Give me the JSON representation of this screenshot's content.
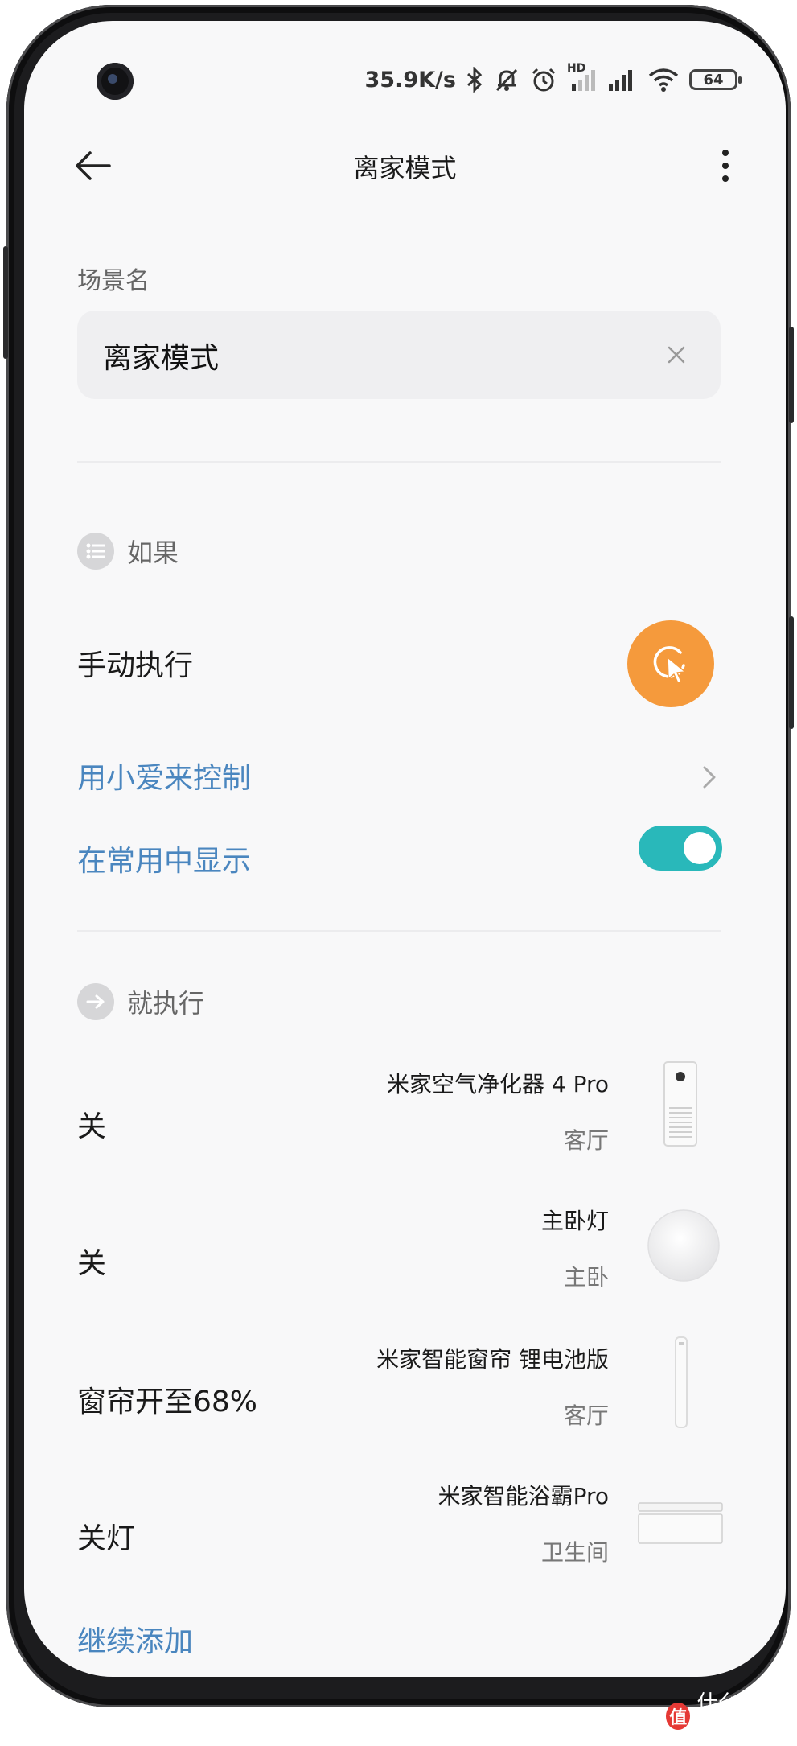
{
  "status_bar": {
    "net_speed": "35.9K/s",
    "hd_label": "HD",
    "battery": "64",
    "icons": [
      "bluetooth-icon",
      "muted-bell-icon",
      "alarm-icon",
      "signal-icon",
      "signal-icon",
      "wifi-icon",
      "battery-icon"
    ]
  },
  "header": {
    "title": "离家模式"
  },
  "scene": {
    "label": "场景名",
    "value": "离家模式"
  },
  "if_section": {
    "title": "如果",
    "condition": "手动执行",
    "xiaoai_label": "用小爱来控制",
    "show_common_label": "在常用中显示",
    "show_common_enabled": true,
    "accent_color": "#f59a3c",
    "toggle_color": "#29b8ba"
  },
  "then_section": {
    "title": "就执行",
    "actions": [
      {
        "action": "关",
        "device": "米家空气净化器 4 Pro",
        "room": "客厅",
        "thumb": "air-purifier"
      },
      {
        "action": "关",
        "device": "主卧灯",
        "room": "主卧",
        "thumb": "ceiling-light"
      },
      {
        "action": "窗帘开至68%",
        "device": "米家智能窗帘 锂电池版",
        "room": "客厅",
        "thumb": "curtain-motor"
      },
      {
        "action": "关灯",
        "device": "米家智能浴霸Pro",
        "room": "卫生间",
        "thumb": "bath-heater"
      }
    ],
    "add_more": "继续添加"
  },
  "watermark": {
    "text": "什么值得买",
    "badge": "值"
  },
  "colors": {
    "link": "#4a86bf"
  }
}
